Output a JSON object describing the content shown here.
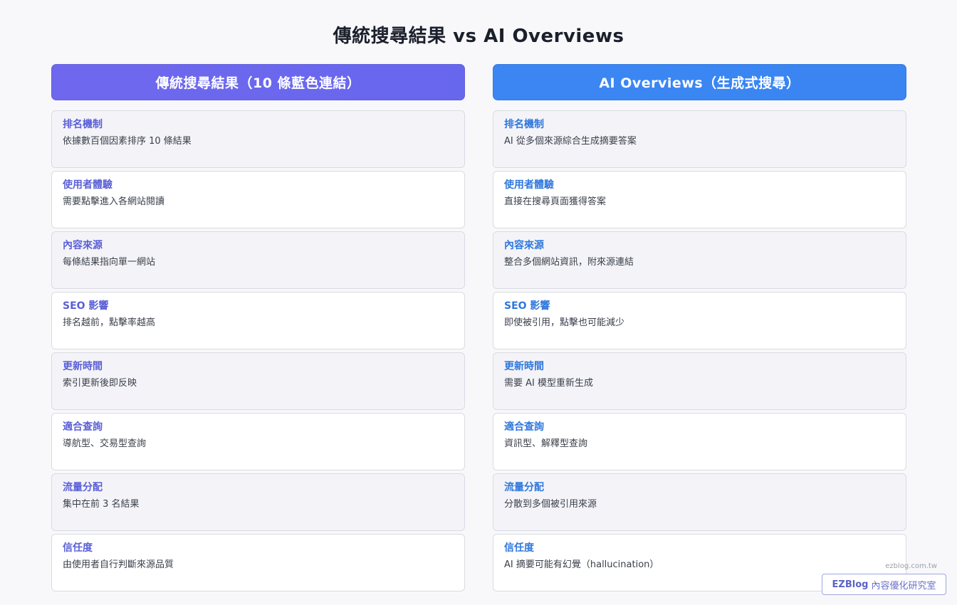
{
  "title": "傳統搜尋結果 vs AI Overviews",
  "left": {
    "header": "傳統搜尋結果（10 條藍色連結）",
    "rows": [
      {
        "title": "排名機制",
        "text": "依據數百個因素排序 10 條結果"
      },
      {
        "title": "使用者體驗",
        "text": "需要點擊進入各網站閱讀"
      },
      {
        "title": "內容來源",
        "text": "每條結果指向單一網站"
      },
      {
        "title": "SEO 影響",
        "text": "排名越前，點擊率越高"
      },
      {
        "title": "更新時間",
        "text": "索引更新後即反映"
      },
      {
        "title": "適合查詢",
        "text": "導航型、交易型查詢"
      },
      {
        "title": "流量分配",
        "text": "集中在前 3 名結果"
      },
      {
        "title": "信任度",
        "text": "由使用者自行判斷來源品質"
      }
    ]
  },
  "right": {
    "header": "AI Overviews（生成式搜尋）",
    "rows": [
      {
        "title": "排名機制",
        "text": "AI 從多個來源綜合生成摘要答案"
      },
      {
        "title": "使用者體驗",
        "text": "直接在搜尋頁面獲得答案"
      },
      {
        "title": "內容來源",
        "text": "整合多個網站資訊，附來源連結"
      },
      {
        "title": "SEO 影響",
        "text": "即使被引用，點擊也可能減少"
      },
      {
        "title": "更新時間",
        "text": "需要 AI 模型重新生成"
      },
      {
        "title": "適合查詢",
        "text": "資訊型、解釋型查詢"
      },
      {
        "title": "流量分配",
        "text": "分散到多個被引用來源"
      },
      {
        "title": "信任度",
        "text": "AI 摘要可能有幻覺（hallucination）"
      }
    ]
  },
  "watermark": {
    "site": "ezblog.com.tw",
    "brand_bold": "EZBlog",
    "brand_rest": "內容優化研究室"
  },
  "colors": {
    "left_header": "#6a67ee",
    "right_header": "#3b86f3",
    "left_accent": "#5a5fd6",
    "right_accent": "#2f77dc"
  }
}
